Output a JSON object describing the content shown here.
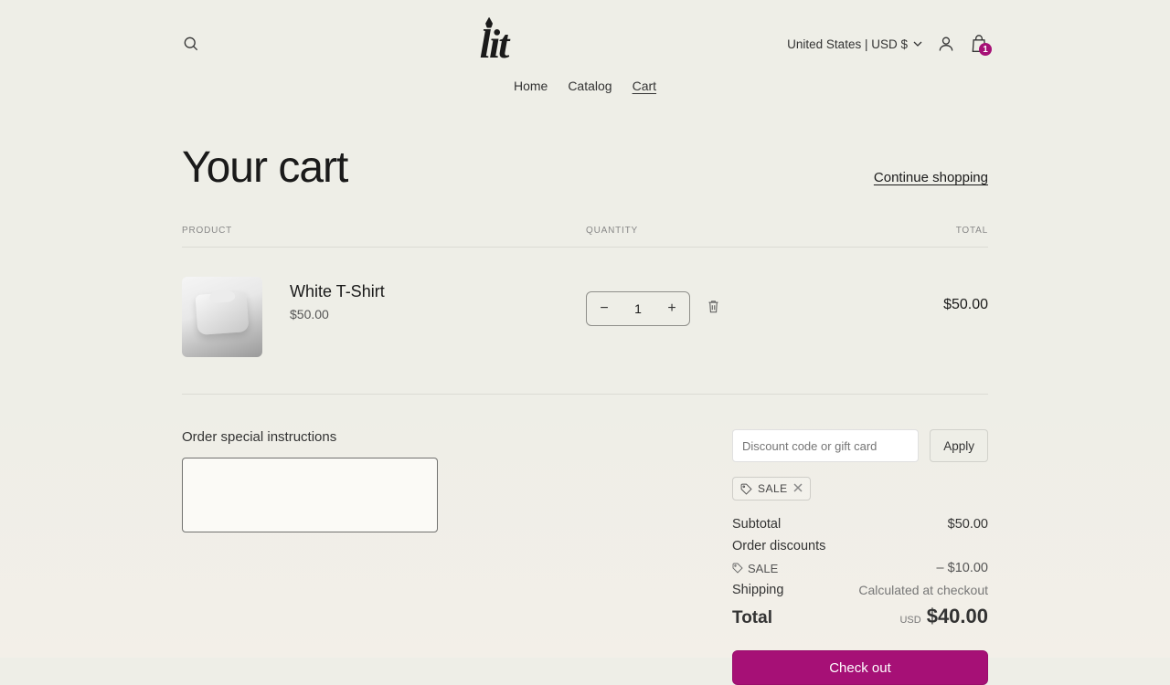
{
  "header": {
    "logo_text": "lit",
    "locale": "United States | USD $",
    "cart_count": "1"
  },
  "nav": {
    "home": "Home",
    "catalog": "Catalog",
    "cart": "Cart"
  },
  "page": {
    "title": "Your cart",
    "continue": "Continue shopping"
  },
  "columns": {
    "product": "PRODUCT",
    "quantity": "QUANTITY",
    "total": "TOTAL"
  },
  "item": {
    "name": "White T-Shirt",
    "price": "$50.00",
    "qty": "1",
    "line_total": "$50.00"
  },
  "instructions": {
    "label": "Order special instructions",
    "value": ""
  },
  "discount": {
    "placeholder": "Discount code or gift card",
    "apply": "Apply",
    "chip": "SALE"
  },
  "summary": {
    "subtotal_label": "Subtotal",
    "subtotal_value": "$50.00",
    "order_discounts_label": "Order discounts",
    "discount_name": "SALE",
    "discount_value": "– $10.00",
    "shipping_label": "Shipping",
    "shipping_value": "Calculated at checkout",
    "total_label": "Total",
    "total_currency": "USD",
    "total_value": "$40.00",
    "checkout": "Check out"
  }
}
